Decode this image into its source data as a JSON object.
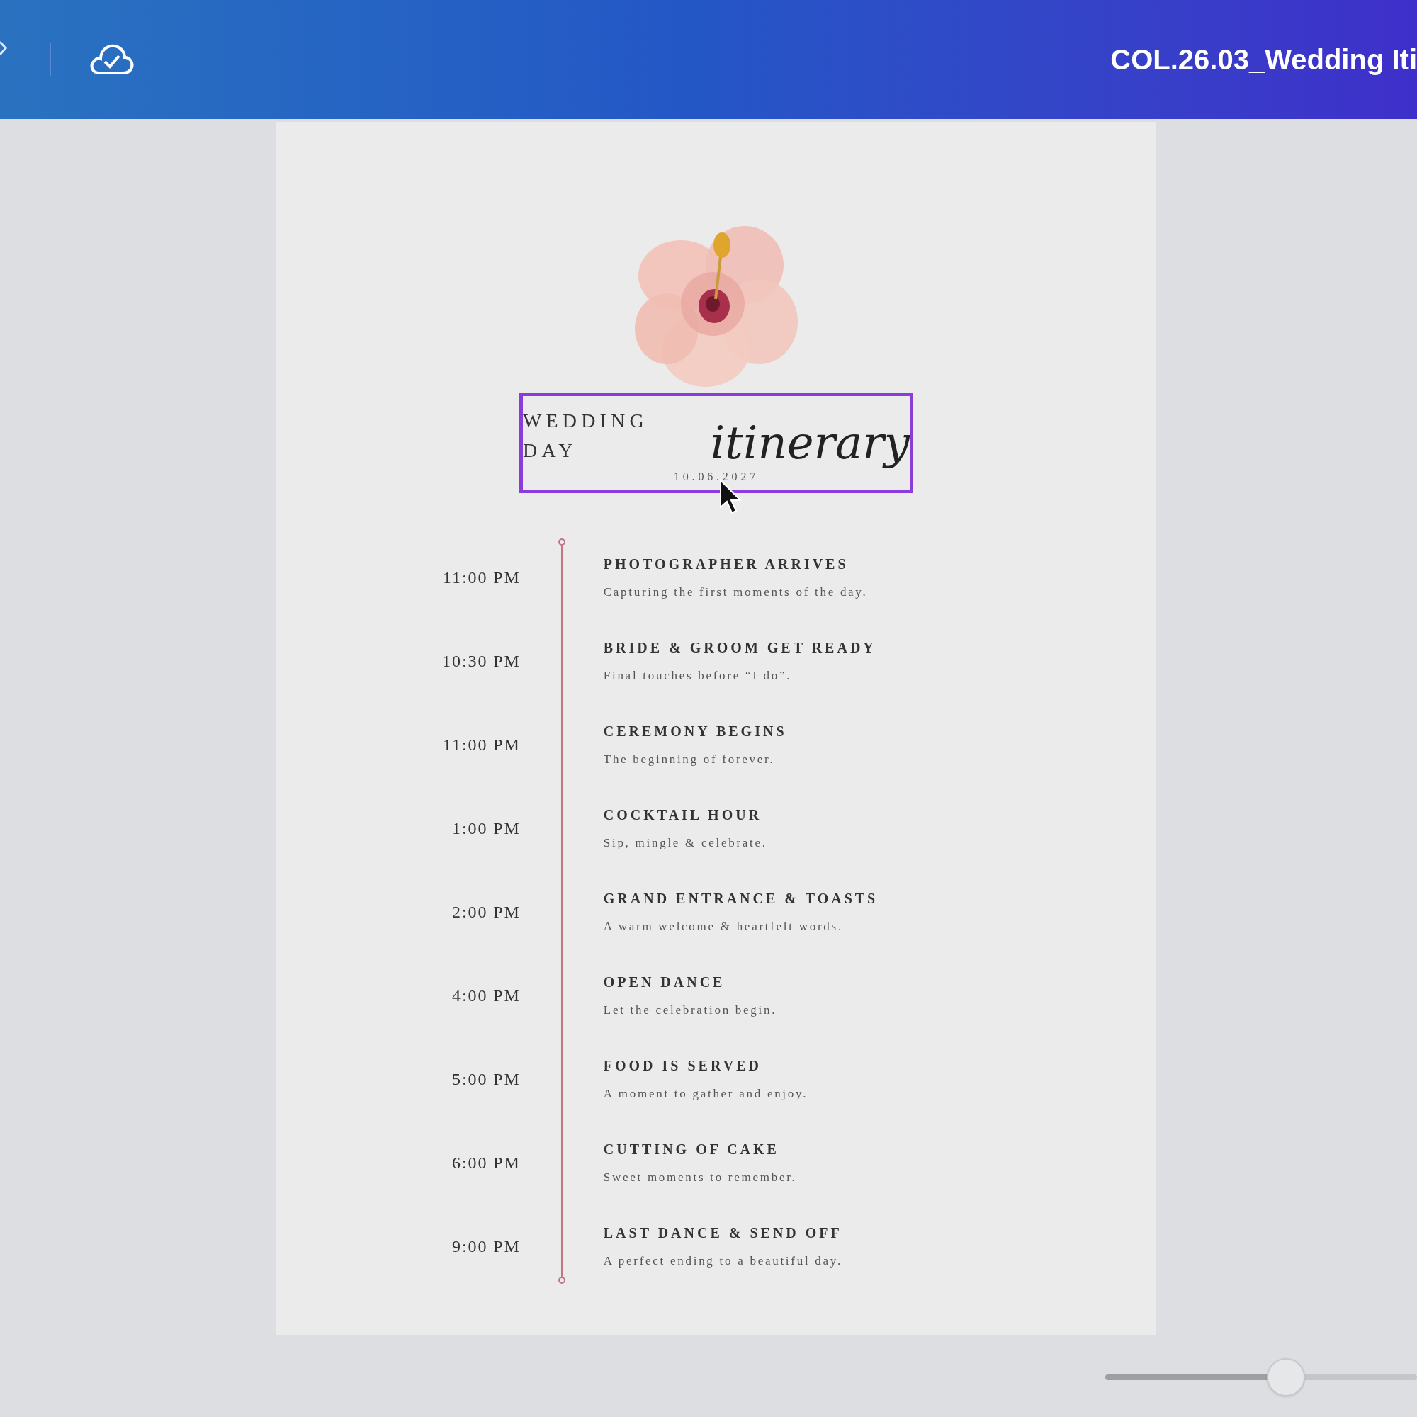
{
  "top_bar": {
    "title": "COL.26.03_Wedding Iti"
  },
  "design": {
    "heading": "WEDDING DAY",
    "script_title": "itinerary",
    "date": "10.06.2027",
    "selected": true,
    "events": [
      {
        "time": "11:00 PM",
        "title": "PHOTOGRAPHER ARRIVES",
        "description": "Capturing the first moments of the day."
      },
      {
        "time": "10:30 PM",
        "title": "BRIDE & GROOM GET READY",
        "description": "Final touches before “I do”."
      },
      {
        "time": "11:00 PM",
        "title": "CEREMONY BEGINS",
        "description": "The beginning of forever."
      },
      {
        "time": "1:00 PM",
        "title": "COCKTAIL HOUR",
        "description": "Sip, mingle & celebrate."
      },
      {
        "time": "2:00 PM",
        "title": "GRAND ENTRANCE & TOASTS",
        "description": "A warm welcome & heartfelt words."
      },
      {
        "time": "4:00 PM",
        "title": "OPEN DANCE",
        "description": "Let the celebration begin."
      },
      {
        "time": "5:00 PM",
        "title": "FOOD IS SERVED",
        "description": "A moment to gather and enjoy."
      },
      {
        "time": "6:00 PM",
        "title": "CUTTING OF CAKE",
        "description": "Sweet moments to remember."
      },
      {
        "time": "9:00 PM",
        "title": "LAST DANCE & SEND OFF",
        "description": "A perfect ending to a beautiful day."
      }
    ]
  },
  "zoom": {
    "level": 0.58
  }
}
